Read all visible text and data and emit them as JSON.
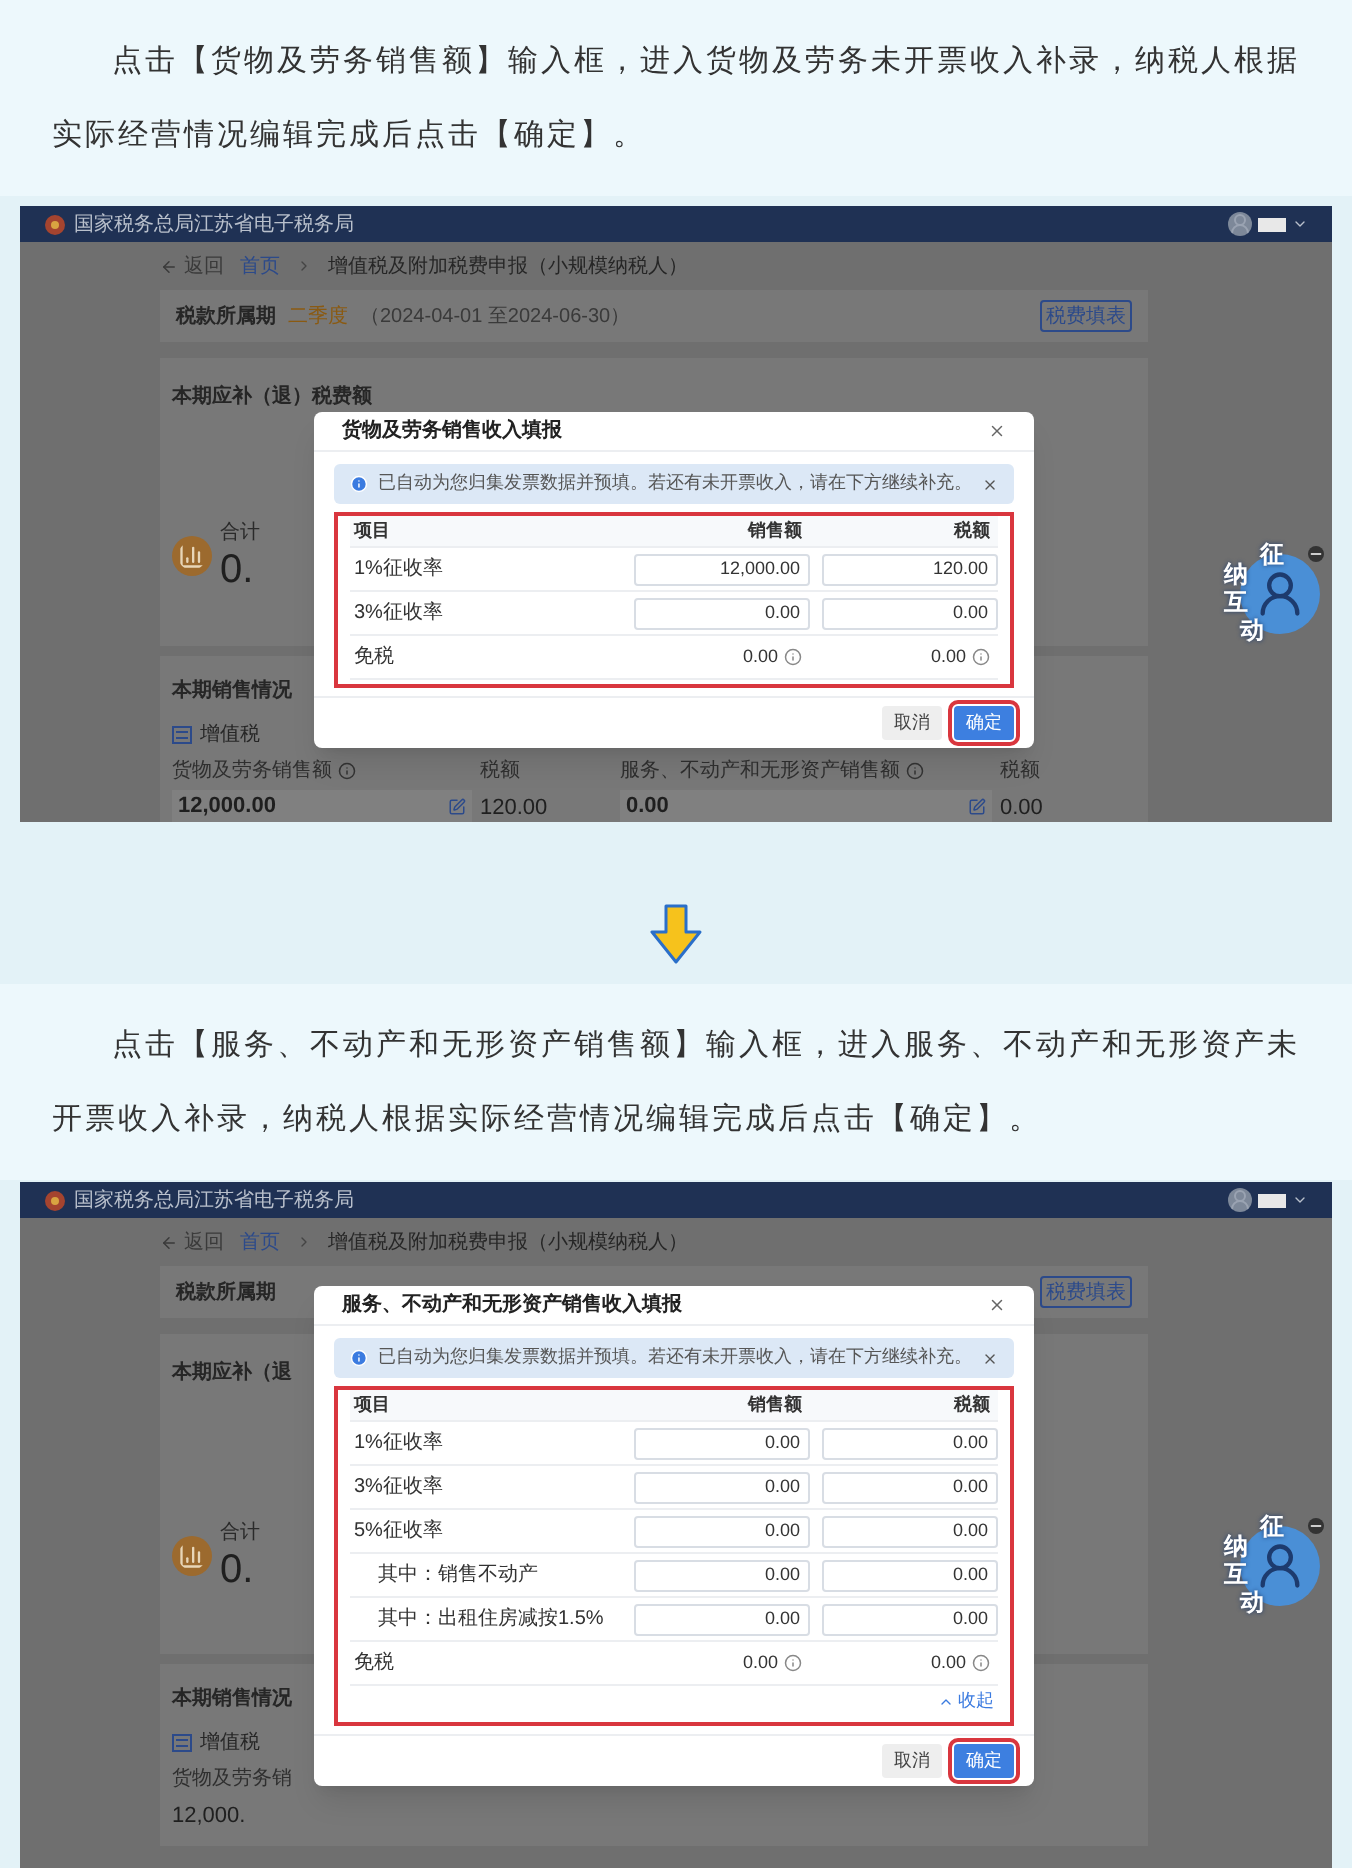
{
  "sections": [
    {
      "instruction": "点击【货物及劳务销售额】输入框，进入货物及劳务未开票收入补录，纳税人根据实际经营情况编辑完成后点击【确定】。",
      "screenshot": {
        "site_title": "国家税务总局江苏省电子税务局",
        "back": "返回",
        "breadcrumb": [
          "首页",
          "增值税及附加税费申报（小规模纳税人）"
        ],
        "period": {
          "label": "税款所属期",
          "value": "二季度",
          "range": "（2024-04-01 至2024-06-30）",
          "button": "税费填表"
        },
        "due": {
          "heading": "本期应补（退）税费额",
          "total_label": "合计",
          "total_value": "0."
        },
        "sales": {
          "heading": "本期销售情况",
          "tab": "增值税",
          "fields": [
            {
              "label": "货物及劳务销售额",
              "value": "12,000.00",
              "kind": "input"
            },
            {
              "label": "税额",
              "value": "120.00",
              "kind": "text"
            },
            {
              "label": "服务、不动产和无形资产销售额",
              "value": "0.00",
              "kind": "input"
            },
            {
              "label": "税额",
              "value": "0.00",
              "kind": "text"
            }
          ]
        },
        "modal": {
          "title": "货物及劳务销售收入填报",
          "notice": "已自动为您归集发票数据并预填。若还有未开票收入，请在下方继续补充。",
          "table": {
            "highlighted": true,
            "columns": [
              "项目",
              "销售额",
              "税额"
            ],
            "rows": [
              {
                "label": "1%征收率",
                "kind": "input",
                "sales": "12,000.00",
                "tax": "120.00"
              },
              {
                "label": "3%征收率",
                "kind": "input",
                "sales": "0.00",
                "tax": "0.00"
              },
              {
                "label": "免税",
                "kind": "text",
                "sales": "0.00",
                "tax": "0.00"
              }
            ]
          },
          "buttons": [
            {
              "label": "取消",
              "kind": "secondary",
              "highlighted": false
            },
            {
              "label": "确定",
              "kind": "primary",
              "highlighted": true
            }
          ]
        },
        "mascot": [
          "征",
          "纳",
          "互",
          "动"
        ]
      }
    },
    {
      "instruction": "点击【服务、不动产和无形资产销售额】输入框，进入服务、不动产和无形资产未开票收入补录，纳税人根据实际经营情况编辑完成后点击【确定】。",
      "screenshot": {
        "site_title": "国家税务总局江苏省电子税务局",
        "back": "返回",
        "breadcrumb": [
          "首页",
          "增值税及附加税费申报（小规模纳税人）"
        ],
        "period": {
          "label": "税款所属期",
          "button": "税费填表"
        },
        "due": {
          "heading": "本期应补（退",
          "total_label": "合计",
          "total_value": "0."
        },
        "sales": {
          "heading": "本期销售情况",
          "tab": "增值税",
          "fields": [
            {
              "label": "货物及劳务销",
              "value": "12,000.",
              "kind": "text"
            }
          ]
        },
        "modal": {
          "title": "服务、不动产和无形资产销售收入填报",
          "notice": "已自动为您归集发票数据并预填。若还有未开票收入，请在下方继续补充。",
          "table": {
            "highlighted": true,
            "columns": [
              "项目",
              "销售额",
              "税额"
            ],
            "rows": [
              {
                "label": "1%征收率",
                "kind": "input",
                "sales": "0.00",
                "tax": "0.00"
              },
              {
                "label": "3%征收率",
                "kind": "input",
                "sales": "0.00",
                "tax": "0.00"
              },
              {
                "label": "5%征收率",
                "kind": "input",
                "sales": "0.00",
                "tax": "0.00",
                "children": [
                  {
                    "label": "其中：销售不动产",
                    "kind": "input",
                    "sales": "0.00",
                    "tax": "0.00"
                  },
                  {
                    "label": "其中：出租住房减按1.5%",
                    "kind": "input",
                    "sales": "0.00",
                    "tax": "0.00"
                  }
                ]
              },
              {
                "label": "免税",
                "kind": "text",
                "sales": "0.00",
                "tax": "0.00"
              }
            ]
          },
          "collapse_link": "收起",
          "buttons": [
            {
              "label": "取消",
              "kind": "secondary",
              "highlighted": false
            },
            {
              "label": "确定",
              "kind": "primary",
              "highlighted": true
            }
          ]
        },
        "mascot": [
          "征",
          "纳",
          "互",
          "动"
        ]
      }
    }
  ]
}
